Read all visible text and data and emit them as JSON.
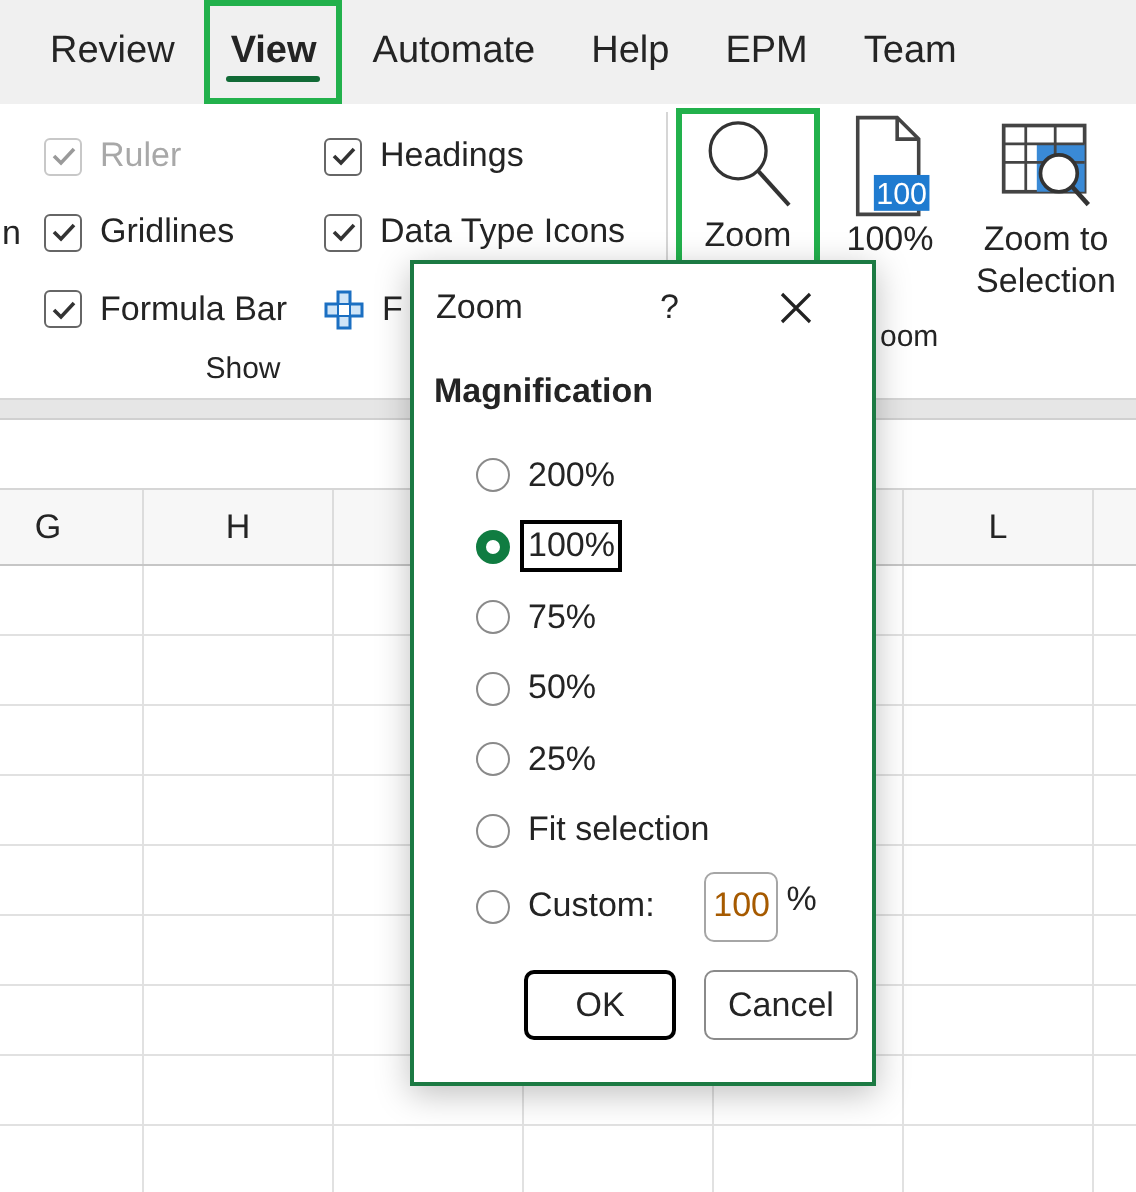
{
  "tabs": [
    {
      "label": "Review",
      "selected": false,
      "highlighted": false
    },
    {
      "label": "View",
      "selected": true,
      "highlighted": true
    },
    {
      "label": "Automate",
      "selected": false,
      "highlighted": false
    },
    {
      "label": "Help",
      "selected": false,
      "highlighted": false
    },
    {
      "label": "EPM",
      "selected": false,
      "highlighted": false
    },
    {
      "label": "Team",
      "selected": false,
      "highlighted": false
    }
  ],
  "ribbon": {
    "cut_text": "n",
    "show_group": {
      "label": "Show",
      "items": [
        {
          "kind": "checkbox",
          "label": "Ruler",
          "checked": true,
          "disabled": true
        },
        {
          "kind": "checkbox",
          "label": "Gridlines",
          "checked": true,
          "disabled": false
        },
        {
          "kind": "checkbox",
          "label": "Formula Bar",
          "checked": true,
          "disabled": false
        },
        {
          "kind": "checkbox",
          "label": "Headings",
          "checked": true,
          "disabled": false
        },
        {
          "kind": "checkbox",
          "label": "Data Type Icons",
          "checked": true,
          "disabled": false
        },
        {
          "kind": "icon",
          "label": "F"
        }
      ]
    },
    "zoom_group": {
      "label": "oom",
      "buttons": [
        {
          "kind": "zoom",
          "label": "Zoom",
          "highlighted": true
        },
        {
          "kind": "page",
          "label": "100%",
          "badge": "100",
          "highlighted": false
        },
        {
          "kind": "selection",
          "label": "Zoom to Selection",
          "highlighted": false
        }
      ]
    }
  },
  "sheet": {
    "columns": [
      {
        "label": "G"
      },
      {
        "label": "H"
      },
      {
        "label": "L"
      }
    ]
  },
  "dialog": {
    "title": "Zoom",
    "help": "?",
    "section": "Magnification",
    "options": [
      {
        "label": "200%",
        "selected": false,
        "focused": false
      },
      {
        "label": "100%",
        "selected": true,
        "focused": true
      },
      {
        "label": "75%",
        "selected": false,
        "focused": false
      },
      {
        "label": "50%",
        "selected": false,
        "focused": false
      },
      {
        "label": "25%",
        "selected": false,
        "focused": false
      },
      {
        "label": "Fit selection",
        "selected": false,
        "focused": false
      },
      {
        "label": "Custom:",
        "selected": false,
        "focused": false,
        "kind": "custom",
        "value": "100",
        "unit": "%"
      }
    ],
    "buttons": [
      {
        "label": "OK",
        "default": true
      },
      {
        "label": "Cancel",
        "default": false
      }
    ]
  }
}
